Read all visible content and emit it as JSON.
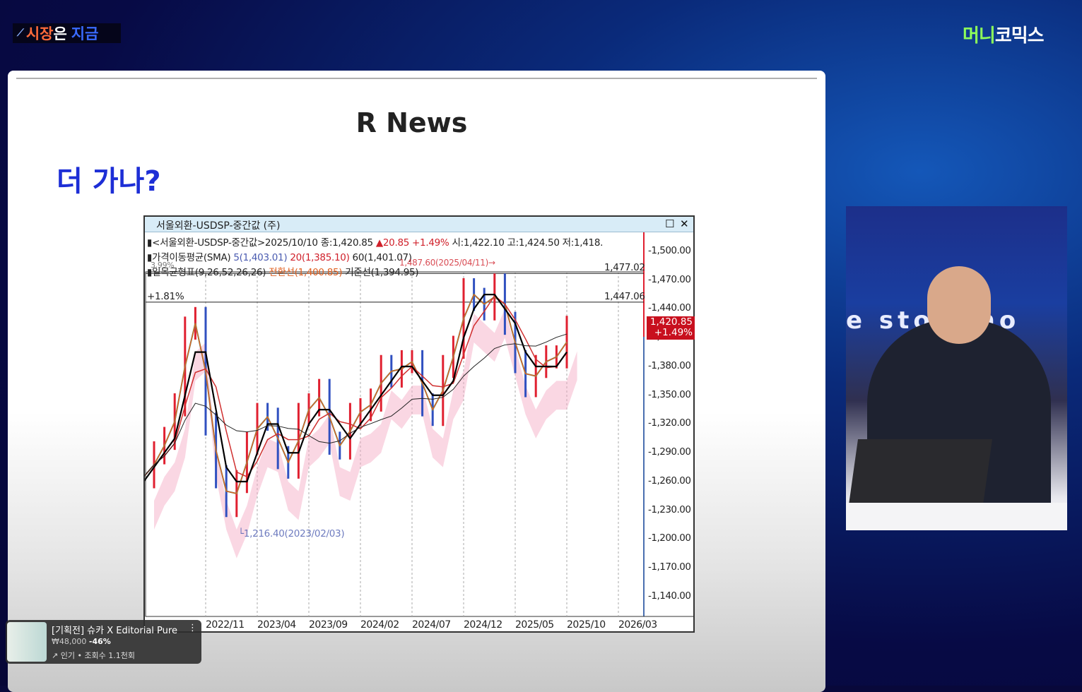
{
  "brand_left": {
    "part1": "시장",
    "part2": "은",
    "part3": "지금"
  },
  "brand_right": {
    "part1": "머니",
    "part2": "코믹스"
  },
  "slide": {
    "title": "R News",
    "subtitle": "더 가나?"
  },
  "chart_window": {
    "title": "서울외환-USDSP-중간값 (주)",
    "header_line1": {
      "name": "<서울외환-USDSP-중간값>",
      "date": "2025/10/10",
      "close": "종:1,420.85",
      "change": "▲20.85",
      "pct": "+1.49%",
      "ohl": "시:1,422.10 고:1,424.50 저:1,418."
    },
    "header_line2": {
      "name": "가격이동평균(SMA)",
      "ma5": "5(1,403.01)",
      "ma20": "20(1,385.10)",
      "ma60": "60(1,401.07)"
    },
    "header_line3": {
      "name": "일목균형표(9,26,52,26,26)",
      "conv": "전환선(1,400.85)",
      "base": "기준선(1,394.95)"
    },
    "annotations": {
      "high": "1,487.60(2025/04/11)→",
      "low": "1,216.40(2023/02/03)",
      "pct_top": "3.99%",
      "pct_mid": "+1.81%",
      "line_top": "1,477.02",
      "line_mid": "1,447.06"
    },
    "price_tag": {
      "value": "1,420.85",
      "pct": "+1.49%"
    }
  },
  "chart_data": {
    "type": "line",
    "title": "서울외환-USDSP-중간값 (주)",
    "x": [
      "2022/05",
      "2022/06",
      "2022/07",
      "2022/08",
      "2022/09",
      "2022/10",
      "2022/11",
      "2022/12",
      "2023/01",
      "2023/02",
      "2023/03",
      "2023/04",
      "2023/05",
      "2023/06",
      "2023/07",
      "2023/08",
      "2023/09",
      "2023/10",
      "2023/11",
      "2023/12",
      "2024/01",
      "2024/02",
      "2024/03",
      "2024/04",
      "2024/05",
      "2024/06",
      "2024/07",
      "2024/08",
      "2024/09",
      "2024/10",
      "2024/11",
      "2024/12",
      "2025/01",
      "2025/02",
      "2025/03",
      "2025/04",
      "2025/05",
      "2025/06",
      "2025/07",
      "2025/08",
      "2025/09",
      "2025/10"
    ],
    "series": [
      {
        "name": "서울외환-USDSP-중간값",
        "values": [
          1265,
          1290,
          1305,
          1340,
          1420,
          1430,
          1320,
          1265,
          1235,
          1260,
          1300,
          1330,
          1325,
          1285,
          1275,
          1330,
          1340,
          1355,
          1300,
          1295,
          1330,
          1335,
          1345,
          1380,
          1370,
          1385,
          1385,
          1340,
          1330,
          1380,
          1400,
          1460,
          1450,
          1440,
          1465,
          1425,
          1385,
          1360,
          1380,
          1390,
          1390,
          1420.85
        ]
      }
    ],
    "x_ticks": [
      "2022/11",
      "2023/04",
      "2023/09",
      "2024/02",
      "2024/07",
      "2024/12",
      "2025/05",
      "2025/10",
      "2026/03"
    ],
    "y_ticks": [
      "1,500.00",
      "1,470.00",
      "1,440.00",
      "1,410.00",
      "1,380.00",
      "1,350.00",
      "1,320.00",
      "1,290.00",
      "1,260.00",
      "1,230.00",
      "1,200.00",
      "1,170.00",
      "1,140.00"
    ],
    "ylim": [
      1130,
      1510
    ],
    "hlines": [
      1477.02,
      1447.06
    ],
    "grid": "vertical dashed",
    "colors": {
      "price": "#d0202a",
      "ma5": "#e06020",
      "ma20": "#d03030",
      "ma60": "#222222",
      "conv": "#20a080",
      "cloud": "#f4a6c0"
    }
  },
  "studio": {
    "backdrop_text": "e sto  s no"
  },
  "ad": {
    "title": "[기획전] 슈카 X Editorial Pure",
    "price": "₩48,000",
    "discount": "-46%",
    "meta": "인기 • 조회수 1.1천회"
  }
}
